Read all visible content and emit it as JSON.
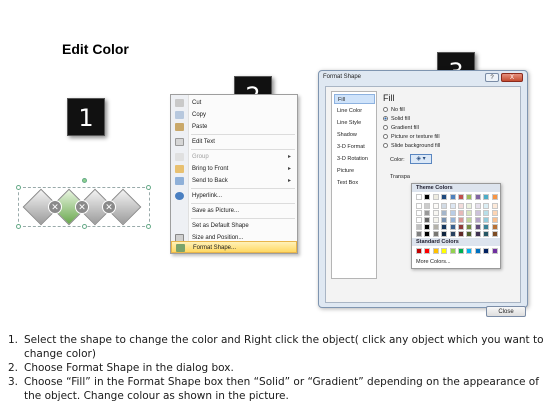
{
  "title": "Edit Color",
  "steps": [
    "1",
    "2",
    "3"
  ],
  "context_menu": {
    "items": [
      {
        "label": "Cut",
        "icon": "scissors-icon"
      },
      {
        "label": "Copy",
        "icon": "copy-icon"
      },
      {
        "label": "Paste",
        "icon": "paste-icon"
      },
      {
        "label": "Edit Text",
        "icon": "edit-text-icon"
      },
      {
        "label": "Group",
        "icon": "group-icon"
      },
      {
        "label": "Bring to Front",
        "icon": "bring-front-icon"
      },
      {
        "label": "Send to Back",
        "icon": "send-back-icon"
      },
      {
        "label": "Hyperlink...",
        "icon": "hyperlink-icon"
      },
      {
        "label": "Save as Picture...",
        "icon": ""
      },
      {
        "label": "Set as Default Shape",
        "icon": ""
      },
      {
        "label": "Size and Position...",
        "icon": "size-position-icon"
      },
      {
        "label": "Format Shape...",
        "icon": "format-shape-icon"
      }
    ]
  },
  "dialog": {
    "title": "Format Shape",
    "help": "?",
    "close_x": "X",
    "categories": [
      "Fill",
      "Line Color",
      "Line Style",
      "Shadow",
      "3-D Format",
      "3-D Rotation",
      "Picture",
      "Text Box"
    ],
    "fill_heading": "Fill",
    "options": [
      "No fill",
      "Solid fill",
      "Gradient fill",
      "Picture or texture fill",
      "Slide background fill"
    ],
    "color_label": "Color:",
    "transparency_label": "Transpa",
    "theme_colors_label": "Theme Colors",
    "standard_colors_label": "Standard Colors",
    "more_colors": "More Colors...",
    "close_button": "Close",
    "theme_colors": [
      "#ffffff",
      "#000000",
      "#eeece1",
      "#1f497d",
      "#4f81bd",
      "#c0504d",
      "#9bbb59",
      "#8064a2",
      "#4bacc6",
      "#f79646"
    ],
    "standard_colors": [
      "#c00000",
      "#ff0000",
      "#ffc000",
      "#ffff00",
      "#92d050",
      "#00b050",
      "#00b0f0",
      "#0070c0",
      "#002060",
      "#7030a0"
    ]
  },
  "instructions": [
    "Select the shape to change the color and Right click the object( click any object which you want to change color)",
    "Choose Format Shape in the dialog box.",
    "Choose “Fill” in the Format Shape box then “Solid” or “Gradient” depending on the appearance of the object. Change colour as shown in the picture."
  ]
}
